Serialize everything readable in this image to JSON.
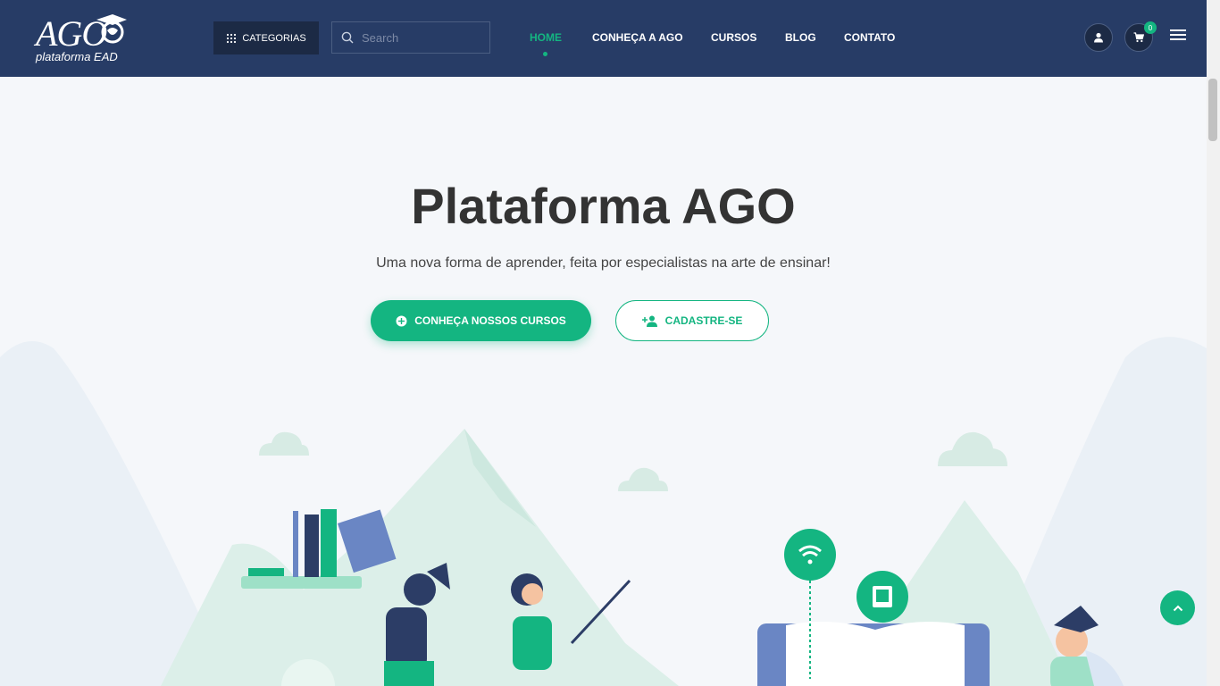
{
  "brand": {
    "logo_text": "AGO",
    "logo_subtext": "plataforma EAD"
  },
  "header": {
    "categories_label": "CATEGORIAS",
    "search_placeholder": "Search",
    "nav": [
      {
        "label": "HOME",
        "active": true
      },
      {
        "label": "CONHEÇA A AGO",
        "active": false
      },
      {
        "label": "CURSOS",
        "active": false
      },
      {
        "label": "BLOG",
        "active": false
      },
      {
        "label": "CONTATO",
        "active": false
      }
    ],
    "cart_count": "0"
  },
  "hero": {
    "title": "Plataforma AGO",
    "subtitle": "Uma nova forma de aprender, feita por especialistas na arte de ensinar!",
    "primary_button": "CONHEÇA NOSSOS CURSOS",
    "secondary_button": "CADASTRE-SE"
  },
  "colors": {
    "header_bg": "#273c66",
    "accent": "#14b581",
    "page_bg": "#f5f7fa"
  },
  "icons": [
    "grid-icon",
    "search-icon",
    "user-icon",
    "cart-icon",
    "menu-icon",
    "plus-circle-icon",
    "user-plus-icon",
    "chevron-up-icon",
    "wifi-icon",
    "book-icon"
  ]
}
